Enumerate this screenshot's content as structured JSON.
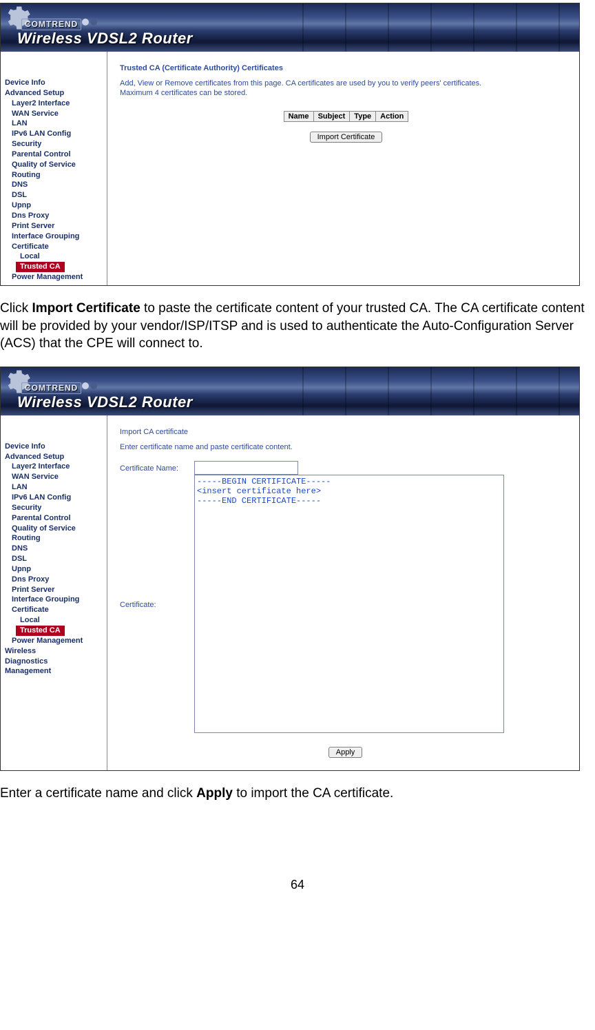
{
  "banner": {
    "brand": "COMTREND",
    "title": "Wireless VDSL2 Router"
  },
  "sidebar1": {
    "items": [
      {
        "label": "Device Info",
        "cls": ""
      },
      {
        "label": "Advanced Setup",
        "cls": ""
      },
      {
        "label": "Layer2 Interface",
        "cls": "sb-sub"
      },
      {
        "label": "WAN Service",
        "cls": "sb-sub"
      },
      {
        "label": "LAN",
        "cls": "sb-sub"
      },
      {
        "label": "IPv6 LAN Config",
        "cls": "sb-sub"
      },
      {
        "label": "Security",
        "cls": "sb-sub"
      },
      {
        "label": "Parental Control",
        "cls": "sb-sub"
      },
      {
        "label": "Quality of Service",
        "cls": "sb-sub"
      },
      {
        "label": "Routing",
        "cls": "sb-sub"
      },
      {
        "label": "DNS",
        "cls": "sb-sub"
      },
      {
        "label": "DSL",
        "cls": "sb-sub"
      },
      {
        "label": "Upnp",
        "cls": "sb-sub"
      },
      {
        "label": "Dns Proxy",
        "cls": "sb-sub"
      },
      {
        "label": "Print Server",
        "cls": "sb-sub"
      },
      {
        "label": "Interface Grouping",
        "cls": "sb-sub"
      },
      {
        "label": "Certificate",
        "cls": "sb-sub"
      },
      {
        "label": "Local",
        "cls": "sb-sub2"
      },
      {
        "label": "Trusted CA",
        "cls": "sb-active"
      },
      {
        "label": "Power Management",
        "cls": "sb-sub"
      }
    ]
  },
  "sidebar2": {
    "items": [
      {
        "label": "Device Info",
        "cls": ""
      },
      {
        "label": "Advanced Setup",
        "cls": ""
      },
      {
        "label": "Layer2 Interface",
        "cls": "sb-sub"
      },
      {
        "label": "WAN Service",
        "cls": "sb-sub"
      },
      {
        "label": "LAN",
        "cls": "sb-sub"
      },
      {
        "label": "IPv6 LAN Config",
        "cls": "sb-sub"
      },
      {
        "label": "Security",
        "cls": "sb-sub"
      },
      {
        "label": "Parental Control",
        "cls": "sb-sub"
      },
      {
        "label": "Quality of Service",
        "cls": "sb-sub"
      },
      {
        "label": "Routing",
        "cls": "sb-sub"
      },
      {
        "label": "DNS",
        "cls": "sb-sub"
      },
      {
        "label": "DSL",
        "cls": "sb-sub"
      },
      {
        "label": "Upnp",
        "cls": "sb-sub"
      },
      {
        "label": "Dns Proxy",
        "cls": "sb-sub"
      },
      {
        "label": "Print Server",
        "cls": "sb-sub"
      },
      {
        "label": "Interface Grouping",
        "cls": "sb-sub"
      },
      {
        "label": "Certificate",
        "cls": "sb-sub"
      },
      {
        "label": "Local",
        "cls": "sb-sub2"
      },
      {
        "label": "Trusted CA",
        "cls": "sb-active"
      },
      {
        "label": "Power Management",
        "cls": "sb-sub"
      },
      {
        "label": "Wireless",
        "cls": ""
      },
      {
        "label": "Diagnostics",
        "cls": ""
      },
      {
        "label": "Management",
        "cls": ""
      }
    ]
  },
  "shot1": {
    "title": "Trusted CA (Certificate Authority) Certificates",
    "desc1": "Add, View or Remove certificates from this page. CA certificates are used by you to verify peers' certificates.",
    "desc2": "Maximum 4 certificates can be stored.",
    "table_headers": [
      "Name",
      "Subject",
      "Type",
      "Action"
    ],
    "import_button": "Import Certificate"
  },
  "shot2": {
    "title": "Import CA certificate",
    "desc": "Enter certificate name and paste certificate content.",
    "name_label": "Certificate Name:",
    "name_value": "",
    "cert_label": "Certificate:",
    "cert_value": "-----BEGIN CERTIFICATE-----\n<insert certificate here>\n-----END CERTIFICATE-----",
    "apply_button": "Apply"
  },
  "doc": {
    "para1_pre": "Click ",
    "para1_bold": "Import Certificate",
    "para1_post": " to paste the certificate content of your trusted CA.   The CA certificate content will be provided by your vendor/ISP/ITSP and is used to authenticate the Auto-Configuration Server (ACS) that the CPE will connect to.",
    "para2_pre": "Enter a certificate name and click ",
    "para2_bold": "Apply",
    "para2_post": " to import the CA certificate.",
    "page_num": "64"
  }
}
